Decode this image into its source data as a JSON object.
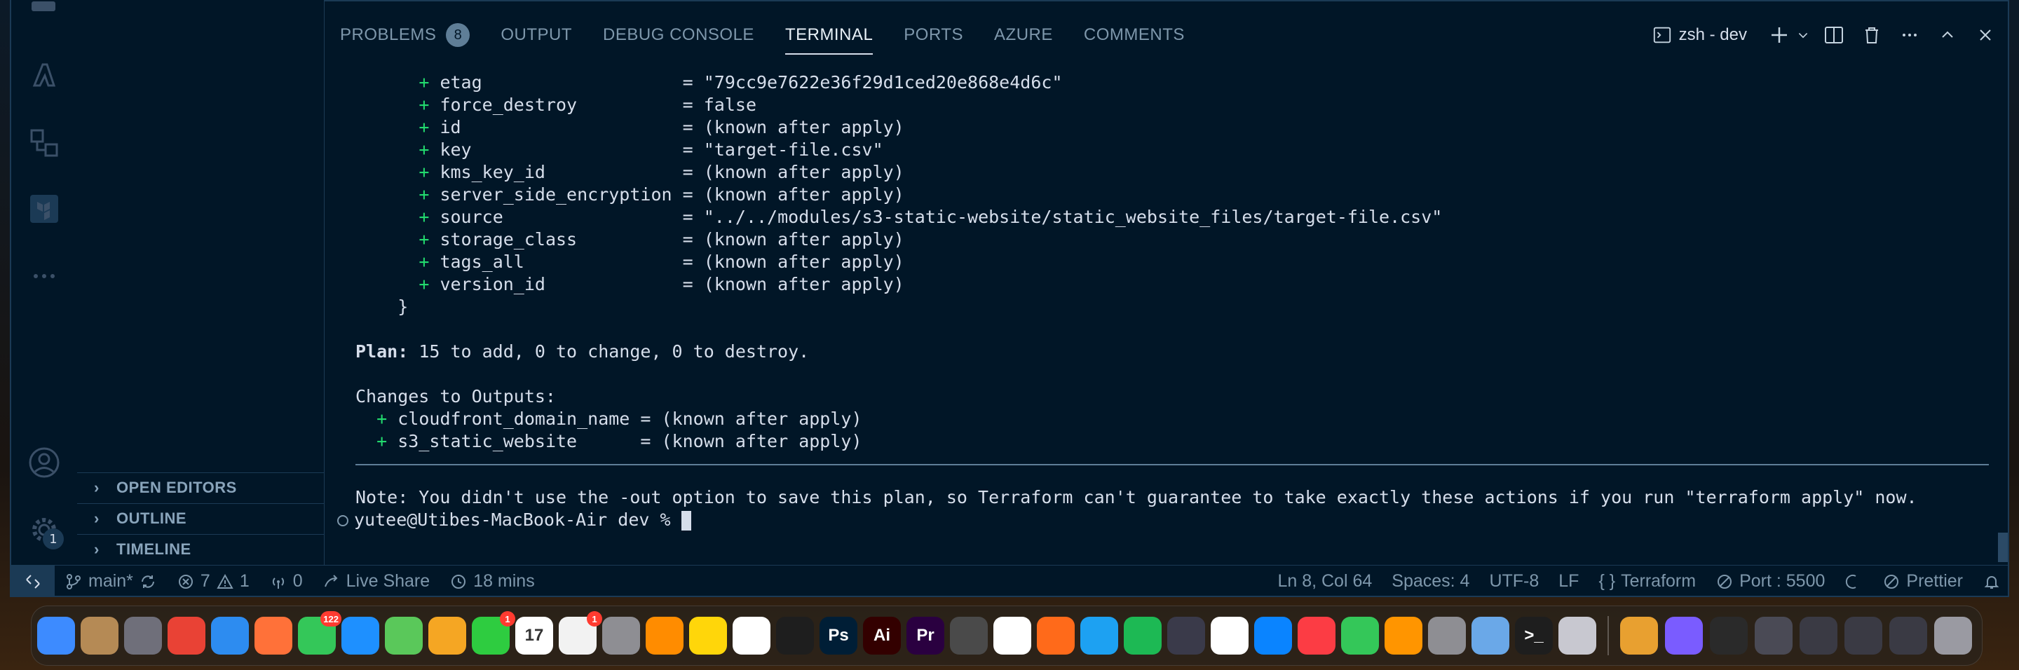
{
  "panel": {
    "tabs": [
      {
        "label": "PROBLEMS",
        "badge": "8"
      },
      {
        "label": "OUTPUT"
      },
      {
        "label": "DEBUG CONSOLE"
      },
      {
        "label": "TERMINAL"
      },
      {
        "label": "PORTS"
      },
      {
        "label": "AZURE"
      },
      {
        "label": "COMMENTS"
      }
    ],
    "active_tab": "TERMINAL",
    "terminal_name": "zsh - dev"
  },
  "sidebar": {
    "sections": [
      "OPEN EDITORS",
      "OUTLINE",
      "TIMELINE"
    ],
    "settings_badge": "1"
  },
  "terminal": {
    "attributes": [
      {
        "plus": "+",
        "key": "etag                  ",
        "eq": "= ",
        "value": "\"79cc9e7622e36f29d1ced20e868e4d6c\""
      },
      {
        "plus": "+",
        "key": "force_destroy         ",
        "eq": "= ",
        "value": "false"
      },
      {
        "plus": "+",
        "key": "id                    ",
        "eq": "= ",
        "value": "(known after apply)"
      },
      {
        "plus": "+",
        "key": "key                   ",
        "eq": "= ",
        "value": "\"target-file.csv\""
      },
      {
        "plus": "+",
        "key": "kms_key_id            ",
        "eq": "= ",
        "value": "(known after apply)"
      },
      {
        "plus": "+",
        "key": "server_side_encryption",
        "eq": " = ",
        "value": "(known after apply)"
      },
      {
        "plus": "+",
        "key": "source                ",
        "eq": "= ",
        "value": "\"../../modules/s3-static-website/static_website_files/target-file.csv\""
      },
      {
        "plus": "+",
        "key": "storage_class         ",
        "eq": "= ",
        "value": "(known after apply)"
      },
      {
        "plus": "+",
        "key": "tags_all              ",
        "eq": "= ",
        "value": "(known after apply)"
      },
      {
        "plus": "+",
        "key": "version_id            ",
        "eq": "= ",
        "value": "(known after apply)"
      }
    ],
    "closing_brace": "    }",
    "plan_label": "Plan:",
    "plan_text": " 15 to add, 0 to change, 0 to destroy.",
    "changes_header": "Changes to Outputs:",
    "outputs": [
      {
        "plus": "+",
        "key": "cloudfront_domain_name",
        "eq": " = ",
        "value": "(known after apply)"
      },
      {
        "plus": "+",
        "key": "s3_static_website     ",
        "eq": " = ",
        "value": "(known after apply)"
      }
    ],
    "note": "Note: You didn't use the -out option to save this plan, so Terraform can't guarantee to take exactly these actions if you run \"terraform apply\" now.",
    "prompt": "yutee@Utibes-MacBook-Air dev % "
  },
  "statusbar": {
    "branch": "main*",
    "errors": "7",
    "warnings": "1",
    "ports": "0",
    "live_share": "Live Share",
    "time": "18 mins",
    "position": "Ln 8, Col 64",
    "spaces": "Spaces: 4",
    "encoding": "UTF-8",
    "eol": "LF",
    "language": "Terraform",
    "port": "Port : 5500",
    "prettier": "Prettier"
  },
  "dock": {
    "apps": [
      {
        "name": "finder-icon",
        "color": "#3d8bff",
        "label": ""
      },
      {
        "name": "contacts-icon",
        "color": "#b58a55",
        "label": ""
      },
      {
        "name": "launchpad-icon",
        "color": "#6f6f7a",
        "label": ""
      },
      {
        "name": "chrome-icon",
        "color": "#e94235",
        "label": ""
      },
      {
        "name": "safari-icon",
        "color": "#2d8cf0",
        "label": ""
      },
      {
        "name": "firefox-icon",
        "color": "#ff7139",
        "label": ""
      },
      {
        "name": "messages-icon",
        "color": "#34c759",
        "label": "",
        "badge": "122"
      },
      {
        "name": "mail-icon",
        "color": "#1e90ff",
        "label": ""
      },
      {
        "name": "maps-icon",
        "color": "#5ac85a",
        "label": ""
      },
      {
        "name": "photos-icon",
        "color": "#f5a623",
        "label": ""
      },
      {
        "name": "facetime-icon",
        "color": "#2ecc40",
        "label": "",
        "badge": "1"
      },
      {
        "name": "calendar-icon",
        "color": "#ffffff",
        "label": "17"
      },
      {
        "name": "reminders-icon",
        "color": "#f2f2f2",
        "label": "",
        "badge": "1"
      },
      {
        "name": "calculator-icon",
        "color": "#8e8e93",
        "label": ""
      },
      {
        "name": "books-icon",
        "color": "#ff8c00",
        "label": ""
      },
      {
        "name": "notes-icon",
        "color": "#ffd60a",
        "label": ""
      },
      {
        "name": "freeform-icon",
        "color": "#ffffff",
        "label": ""
      },
      {
        "name": "figma-icon",
        "color": "#1e1e1e",
        "label": ""
      },
      {
        "name": "photoshop-icon",
        "color": "#001e36",
        "label": "Ps"
      },
      {
        "name": "illustrator-icon",
        "color": "#330000",
        "label": "Ai"
      },
      {
        "name": "premiere-icon",
        "color": "#2a0040",
        "label": "Pr"
      },
      {
        "name": "sublime-icon",
        "color": "#4a4a4a",
        "label": ""
      },
      {
        "name": "vscode-icon",
        "color": "#ffffff",
        "label": ""
      },
      {
        "name": "pen-tool-icon",
        "color": "#ff6a1a",
        "label": ""
      },
      {
        "name": "twitter-icon",
        "color": "#1da1f2",
        "label": ""
      },
      {
        "name": "spotify-icon",
        "color": "#1db954",
        "label": ""
      },
      {
        "name": "davinci-icon",
        "color": "#3a3a4a",
        "label": ""
      },
      {
        "name": "slack-icon",
        "color": "#ffffff",
        "label": ""
      },
      {
        "name": "app-store-icon",
        "color": "#0a84ff",
        "label": ""
      },
      {
        "name": "music-icon",
        "color": "#fc3c44",
        "label": ""
      },
      {
        "name": "numbers-icon",
        "color": "#34c759",
        "label": ""
      },
      {
        "name": "pages-icon",
        "color": "#ff9500",
        "label": ""
      },
      {
        "name": "system-settings-icon",
        "color": "#8e8e93",
        "label": ""
      },
      {
        "name": "preview-icon",
        "color": "#6aa8e8",
        "label": ""
      },
      {
        "name": "terminal-icon",
        "color": "#1e1e1e",
        "label": ">_"
      },
      {
        "name": "iphone-mirroring-icon",
        "color": "#c8c8d0",
        "label": ""
      }
    ],
    "right_items": [
      {
        "name": "sandwich-icon",
        "color": "#e8a030",
        "label": ""
      },
      {
        "name": "siri-icon",
        "color": "#7a5cff",
        "label": ""
      },
      {
        "name": "terminal-window-icon",
        "color": "#2a2a2a",
        "label": ""
      },
      {
        "name": "desktop-stack-icon",
        "color": "#4a4a55",
        "label": ""
      },
      {
        "name": "window-stack-icon",
        "color": "#3a3a44",
        "label": ""
      },
      {
        "name": "downloads-stack-icon",
        "color": "#3a3a44",
        "label": ""
      },
      {
        "name": "screenshots-stack-icon",
        "color": "#3a3a44",
        "label": ""
      },
      {
        "name": "trash-icon",
        "color": "#9a9aa2",
        "label": ""
      }
    ]
  }
}
